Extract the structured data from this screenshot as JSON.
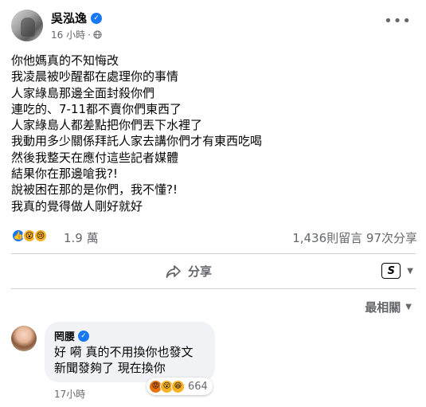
{
  "post": {
    "author": "吳泓逸",
    "time": "16 小時",
    "separator": "·",
    "lines": [
      "你他媽真的不知悔改",
      "我凌晨被吵醒都在處理你的事情",
      "人家綠島那邊全面封殺你們",
      "連吃的、7-11都不賣你們東西了",
      "人家綠島人都差點把你們丟下水裡了",
      "我動用多少關係拜託人家去講你們才有東西吃喝",
      "然後我整天在應付這些記者媒體",
      "結果你在那邊嗆我?!",
      "說被困在那的是你們，我不懂?!",
      "我真的覺得做人剛好就好"
    ]
  },
  "reactions": {
    "icons": [
      "like-icon",
      "wow-icon",
      "sad-icon"
    ],
    "count": "1.9 萬",
    "comments_shares": "1,436則留言  97次分享"
  },
  "actions": {
    "share_label": "分享",
    "audience_badge": "S"
  },
  "sort": {
    "label": "最相關"
  },
  "comment": {
    "author": "罔腰",
    "line1": "好 嗬 真的不用換你也發文",
    "line2": "新聞發夠了 現在換你",
    "reaction_icons": [
      "angry-icon",
      "wow-icon",
      "haha-icon"
    ],
    "reaction_count": "664",
    "time": "17小時"
  },
  "colors": {
    "accent": "#1877f2",
    "secondary_text": "#65676b",
    "bubble": "#f0f2f5"
  }
}
